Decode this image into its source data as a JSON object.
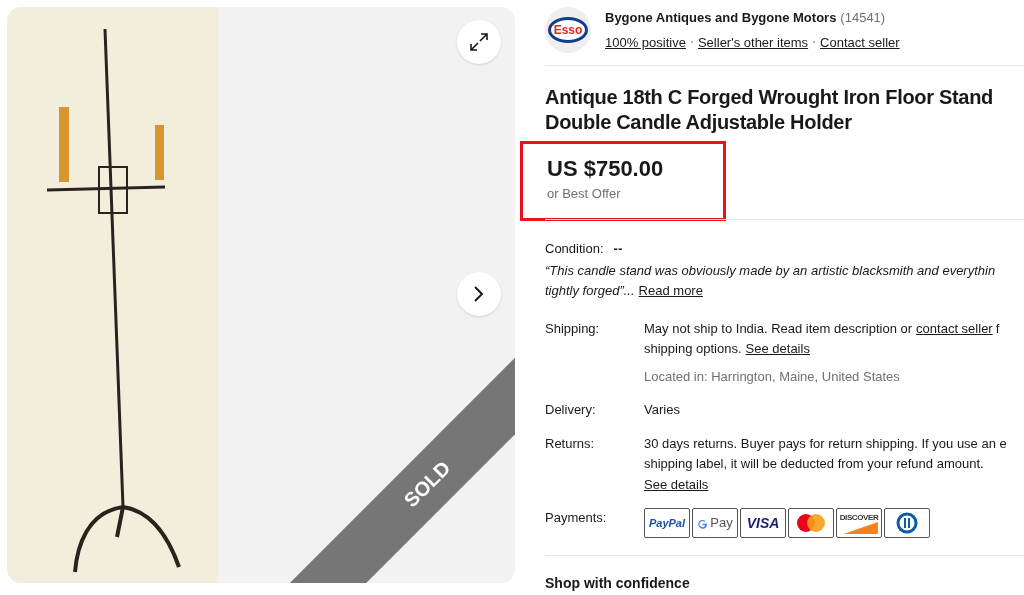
{
  "gallery": {
    "sold_label": "SOLD"
  },
  "seller": {
    "logo_text": "Esso",
    "name": "Bygone Antiques and Bygone Motors",
    "feedback_count": "(14541)",
    "links": [
      "100% positive",
      "Seller's other items",
      "Contact seller"
    ]
  },
  "title_lines": [
    "Antique 18th C Forged Wrought Iron Floor Stand",
    "Double Candle Adjustable Holder"
  ],
  "price": {
    "amount": "US $750.00",
    "note": "or Best Offer",
    "highlighted": true
  },
  "condition": {
    "label": "Condition:",
    "value": "--",
    "quote_line1": "“This candle stand was obviously made by an artistic blacksmith and everythin",
    "quote_line2": "tightly forged”...",
    "read_more": "Read more"
  },
  "shipping": {
    "label": "Shipping:",
    "line1": "May not ship to India. Read item description or",
    "link": "contact seller",
    "line1_end": "f",
    "line2": "shipping options.",
    "details": "See details",
    "location": "Located in: Harrington, Maine, United States"
  },
  "delivery": {
    "label": "Delivery:",
    "value": "Varies"
  },
  "returns": {
    "label": "Returns:",
    "line1": "30 days returns. Buyer pays for return shipping. If you use an e",
    "line2": "shipping label, it will be deducted from your refund amount.",
    "details": "See details"
  },
  "payments": {
    "label": "Payments:",
    "methods": [
      {
        "kind": "paypal",
        "label": "PayPal"
      },
      {
        "kind": "gpay",
        "label": "Pay"
      },
      {
        "kind": "visa",
        "label": "VISA"
      },
      {
        "kind": "mastercard"
      },
      {
        "kind": "discover",
        "label": "DISCOVER"
      },
      {
        "kind": "diners"
      }
    ]
  },
  "confidence_heading": "Shop with confidence"
}
